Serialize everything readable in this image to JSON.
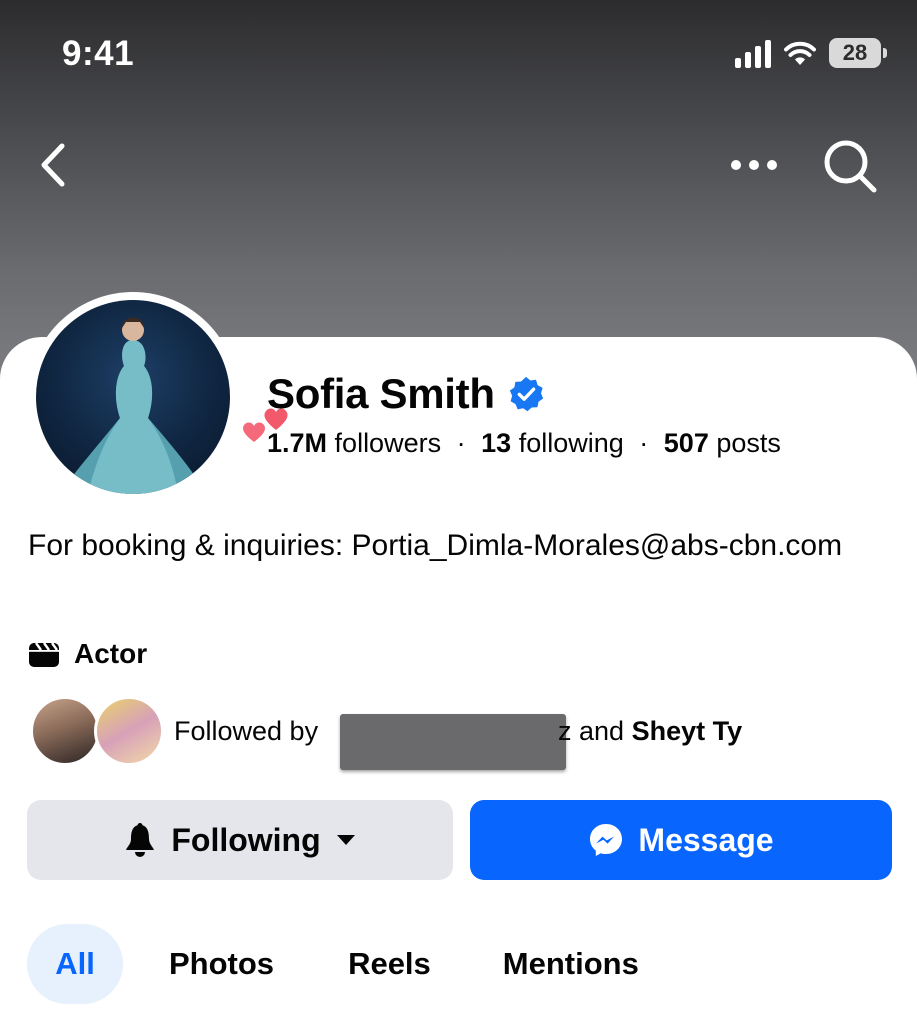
{
  "status_bar": {
    "time": "9:41",
    "battery": "28"
  },
  "nav": {
    "back_icon": "chevron-left-icon",
    "more_icon": "more-dots-icon",
    "search_icon": "search-icon"
  },
  "profile": {
    "name": "Sofia Smith",
    "verified": true,
    "stats": {
      "followers_count": "1.7M",
      "followers_label": "followers",
      "following_count": "13",
      "following_label": "following",
      "posts_count": "507",
      "posts_label": "posts",
      "separator": "·"
    },
    "bio": "For booking & inquiries: Portia_Dimla-Morales@abs-cbn.com",
    "category": "Actor"
  },
  "followed_by": {
    "prefix": "Followed by",
    "tail_text": "z and",
    "last_name": "Sheyt Ty"
  },
  "actions": {
    "following_label": "Following",
    "message_label": "Message"
  },
  "tabs": [
    "All",
    "Photos",
    "Reels",
    "Mentions"
  ],
  "colors": {
    "accent": "#0866ff",
    "verified": "#1877f2",
    "button_gray": "#e4e6eb",
    "tab_active_bg": "#e7f0fd",
    "heart": "#f25a6b"
  }
}
